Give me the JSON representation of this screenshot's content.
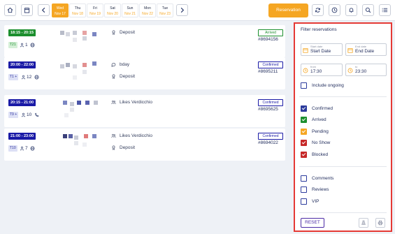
{
  "topbar": {
    "days": [
      {
        "dow": "Wed",
        "date": "Nov 17",
        "active": true
      },
      {
        "dow": "Thu",
        "date": "Nov 18",
        "active": false
      },
      {
        "dow": "Fri",
        "date": "Nov 19",
        "active": false
      },
      {
        "dow": "Sat",
        "date": "Nov 20",
        "active": false
      },
      {
        "dow": "Sun",
        "date": "Nov 21",
        "active": false
      },
      {
        "dow": "Mon",
        "date": "Nov 22",
        "active": false
      },
      {
        "dow": "Tue",
        "date": "Nov 23",
        "active": false
      }
    ],
    "reservation_label": "Reservation",
    "icons": [
      "home-icon",
      "calendar-icon",
      "chevron-left-icon",
      "chevron-right-icon",
      "refresh-icon",
      "clock-icon",
      "bell-icon",
      "search-icon",
      "list-icon"
    ]
  },
  "reservations": [
    {
      "time": "18:15 - 20:15",
      "time_color": "#1c8f2e",
      "table": "T21",
      "guests": "1",
      "contact_icon": "globe-icon",
      "notes": [
        {
          "icon": "medal-icon",
          "text": "Deposit"
        }
      ],
      "status": "Arrived",
      "id": "#8694156"
    },
    {
      "time": "20:00 - 22:00",
      "time_color": "#1a1aa6",
      "table": "T1 +",
      "guests": "12",
      "contact_icon": "globe-icon",
      "notes": [
        {
          "icon": "speech-bubble-icon",
          "text": "bday"
        },
        {
          "icon": "medal-icon",
          "text": "Deposit"
        }
      ],
      "status": "Confirmed",
      "id": "#8695211"
    },
    {
      "time": "20:15 - 21:00",
      "time_color": "#1a1aa6",
      "table": "T9 +",
      "guests": "10",
      "contact_icon": "phone-icon",
      "notes": [
        {
          "icon": "people-icon",
          "text": "Likes Verdicchio"
        }
      ],
      "status": "Confirmed",
      "id": "#8695625"
    },
    {
      "time": "21:00 - 23:00",
      "time_color": "#1a1aa6",
      "table": "T10",
      "guests": "7",
      "contact_icon": "globe-icon",
      "notes": [
        {
          "icon": "people-icon",
          "text": "Likes Verdicchio"
        },
        {
          "icon": "medal-icon",
          "text": "Deposit"
        }
      ],
      "status": "Confirmed",
      "id": "#8694022"
    }
  ],
  "filter": {
    "title": "Filter reservations",
    "start_date": {
      "label": "Start date",
      "value": "Start Date"
    },
    "end_date": {
      "label": "End date",
      "value": "End Date"
    },
    "from": {
      "label": "from",
      "value": "17:30"
    },
    "to": {
      "label": "to",
      "value": "23:30"
    },
    "include_ongoing": "Include ongoing",
    "statuses": [
      {
        "label": "Confirmed",
        "color": "#2b3a9c",
        "checked": true
      },
      {
        "label": "Arrived",
        "color": "#1c8f2e",
        "checked": true
      },
      {
        "label": "Pending",
        "color": "#f5a623",
        "checked": true
      },
      {
        "label": "No Show",
        "color": "#c62828",
        "checked": true
      },
      {
        "label": "Blocked",
        "color": "#c62828",
        "checked": true
      }
    ],
    "extras": [
      {
        "label": "Comments",
        "checked": false
      },
      {
        "label": "Reviews",
        "checked": false
      },
      {
        "label": "VIP",
        "checked": false
      }
    ],
    "reset_label": "RESET"
  },
  "colors": {
    "accent": "#f5a623",
    "highlight_border": "#e53935"
  }
}
